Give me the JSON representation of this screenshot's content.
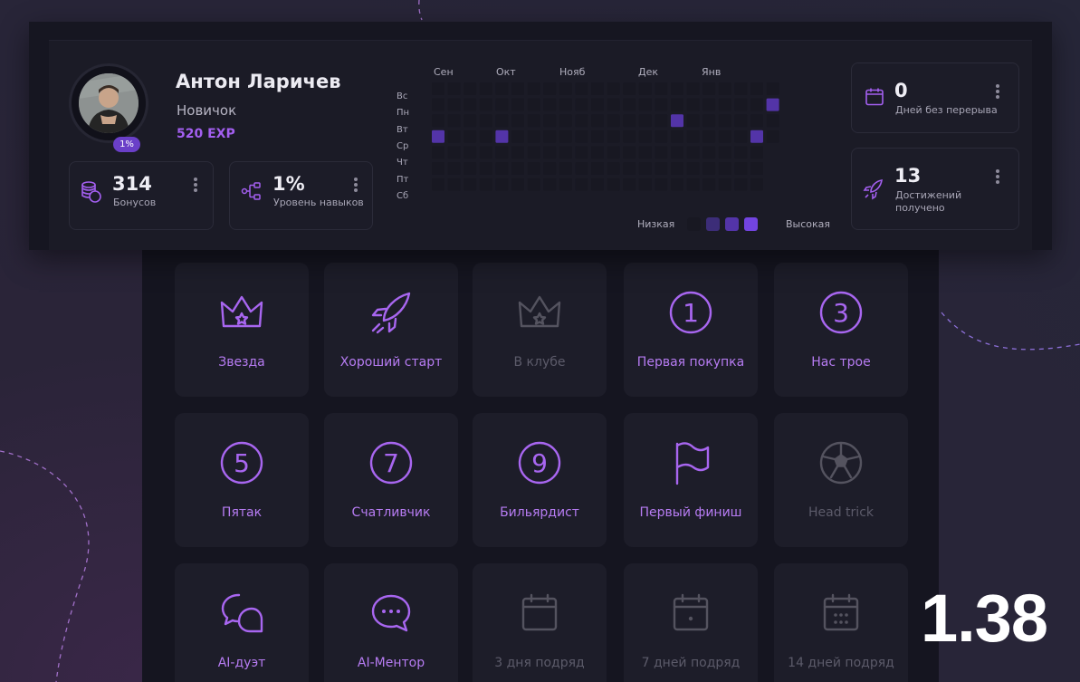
{
  "profile": {
    "name": "Антон Ларичев",
    "rank": "Новичок",
    "exp": "520 EXP",
    "level_badge": "1%",
    "avatar_icon": "user-photo"
  },
  "stats": {
    "bonuses": {
      "value": "314",
      "label": "Бонусов",
      "icon": "coins-icon"
    },
    "skills": {
      "value": "1%",
      "label": "Уровень навыков",
      "icon": "skill-tree-icon"
    },
    "streak": {
      "value": "0",
      "label": "Дней без перерыва",
      "icon": "calendar-icon"
    },
    "achievements": {
      "value": "13",
      "label_line1": "Достижений",
      "label_line2": "получено",
      "icon": "rocket-icon"
    }
  },
  "heatmap": {
    "months": [
      "Сен",
      "Окт",
      "Нояб",
      "Дек",
      "Янв"
    ],
    "days": [
      "Вс",
      "Пн",
      "Вт",
      "Ср",
      "Чт",
      "Пт",
      "Сб"
    ],
    "legend_low": "Низкая",
    "legend_high": "Высокая",
    "colors": [
      "#181822",
      "#3c2d78",
      "#5334a8",
      "#7244e0"
    ],
    "active_cells": [
      {
        "week": 0,
        "day": 3,
        "level": 2
      },
      {
        "week": 4,
        "day": 3,
        "level": 2
      },
      {
        "week": 15,
        "day": 2,
        "level": 2
      },
      {
        "week": 20,
        "day": 3,
        "level": 2
      },
      {
        "week": 21,
        "day": 1,
        "level": 2
      }
    ]
  },
  "achievements": [
    {
      "label": "Звезда",
      "icon": "crown-icon",
      "active": true
    },
    {
      "label": "Хороший старт",
      "icon": "rocket-icon",
      "active": true
    },
    {
      "label": "В клубе",
      "icon": "crown-icon",
      "active": false
    },
    {
      "label": "Первая покупка",
      "icon": "number-1-icon",
      "active": true
    },
    {
      "label": "Нас трое",
      "icon": "number-3-icon",
      "active": true
    },
    {
      "label": "Пятак",
      "icon": "number-5-icon",
      "active": true
    },
    {
      "label": "Счатливчик",
      "icon": "number-7-icon",
      "active": true
    },
    {
      "label": "Бильярдист",
      "icon": "number-9-icon",
      "active": true
    },
    {
      "label": "Первый финиш",
      "icon": "flag-icon",
      "active": true
    },
    {
      "label": "Head trick",
      "icon": "soccer-ball-icon",
      "active": false
    },
    {
      "label": "AI-дуэт",
      "icon": "chat-bubbles-icon",
      "active": true
    },
    {
      "label": "AI-Ментор",
      "icon": "chat-dots-icon",
      "active": true
    },
    {
      "label": "3 дня подряд",
      "icon": "calendar-icon",
      "active": false
    },
    {
      "label": "7 дней подряд",
      "icon": "calendar-dot-icon",
      "active": false
    },
    {
      "label": "14 дней подряд",
      "icon": "calendar-dots-icon",
      "active": false
    }
  ],
  "version": "1.38"
}
